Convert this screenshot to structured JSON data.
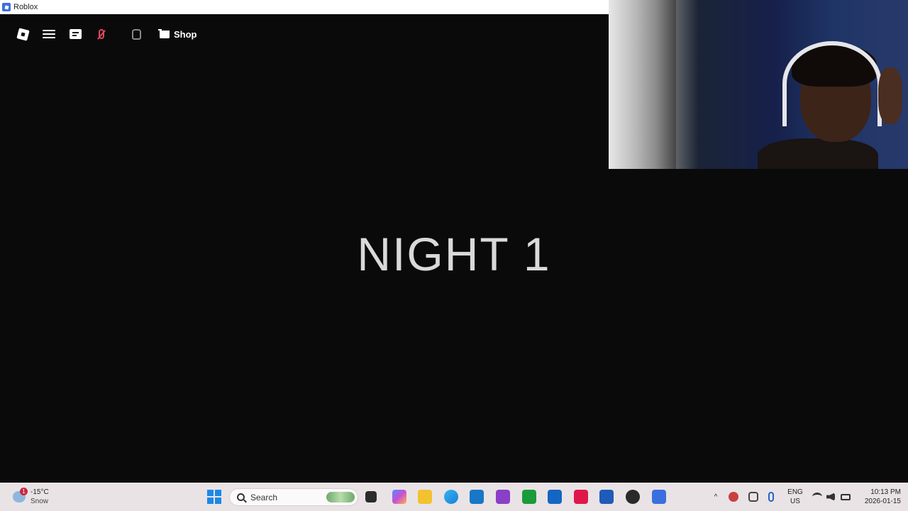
{
  "window": {
    "title": "Roblox"
  },
  "game": {
    "topbar": {
      "shop_label": "Shop"
    },
    "center_text": "NIGHT 1"
  },
  "taskbar": {
    "weather": {
      "badge": "1",
      "temperature": "-15°C",
      "condition": "Snow"
    },
    "search_label": "Search",
    "language": {
      "line1": "ENG",
      "line2": "US"
    },
    "clock": {
      "time": "10:13 PM",
      "date": "2026-01-15"
    }
  },
  "colors": {
    "mic_muted": "#e1455c",
    "taskbar_bg": "#e9e3e6",
    "game_bg": "#0a0a0a"
  }
}
